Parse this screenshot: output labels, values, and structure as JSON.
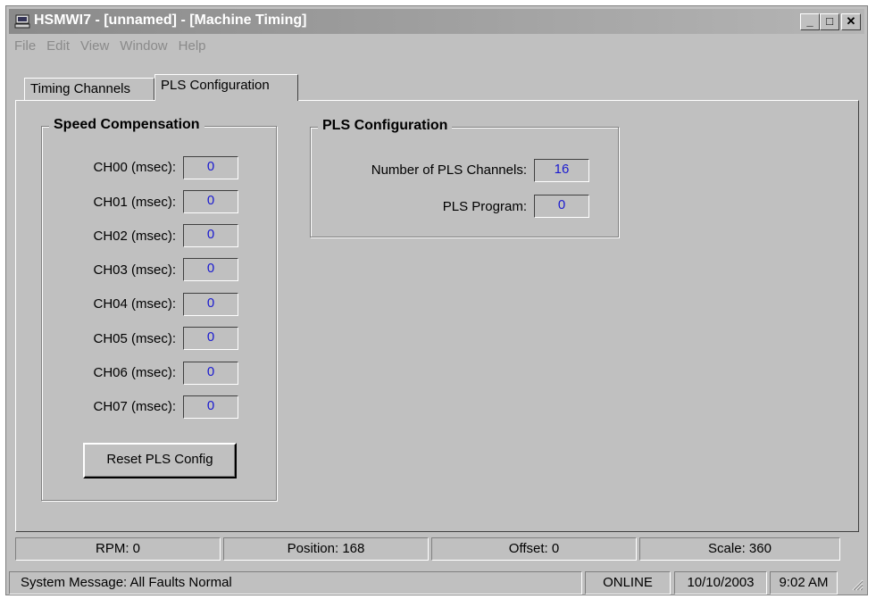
{
  "window": {
    "title": "HSMWI7 - [unnamed] - [Machine Timing]",
    "minimize_label": "_",
    "maximize_label": "□",
    "close_label": "✕"
  },
  "menu": [
    "File",
    "Edit",
    "View",
    "Window",
    "Help"
  ],
  "tabs": [
    {
      "label": "Timing Channels",
      "active": false
    },
    {
      "label": "PLS Configuration",
      "active": true
    }
  ],
  "speed_compensation": {
    "title": "Speed Compensation",
    "channels": [
      {
        "label": "CH00 (msec):",
        "value": "0"
      },
      {
        "label": "CH01 (msec):",
        "value": "0"
      },
      {
        "label": "CH02 (msec):",
        "value": "0"
      },
      {
        "label": "CH03 (msec):",
        "value": "0"
      },
      {
        "label": "CH04 (msec):",
        "value": "0"
      },
      {
        "label": "CH05 (msec):",
        "value": "0"
      },
      {
        "label": "CH06 (msec):",
        "value": "0"
      },
      {
        "label": "CH07 (msec):",
        "value": "0"
      }
    ],
    "reset_button": "Reset PLS Config"
  },
  "pls_configuration": {
    "title": "PLS Configuration",
    "num_channels_label": "Number of PLS Channels:",
    "num_channels_value": "16",
    "program_label": "PLS Program:",
    "program_value": "0"
  },
  "status_bar_top": {
    "rpm": "RPM: 0",
    "position": "Position: 168",
    "offset": "Offset: 0",
    "scale": "Scale: 360"
  },
  "status_bar_bottom": {
    "message": "System Message: All Faults Normal",
    "connection": "ONLINE",
    "date": "10/10/2003",
    "time": "9:02 AM"
  }
}
